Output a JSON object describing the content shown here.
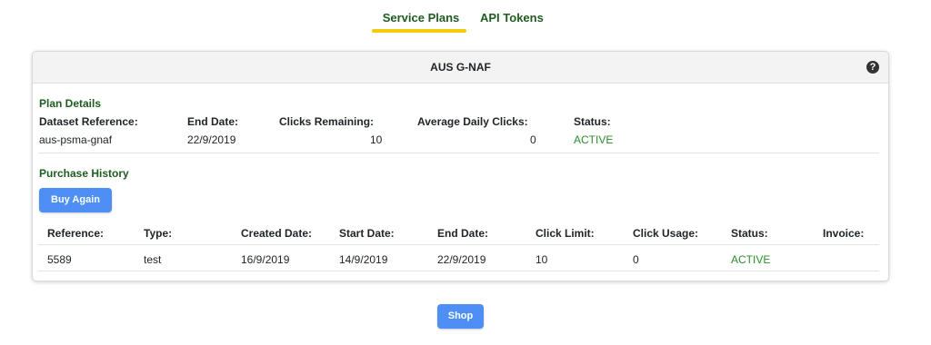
{
  "tabs": [
    {
      "label": "Service Plans",
      "active": true
    },
    {
      "label": "API Tokens",
      "active": false
    }
  ],
  "card": {
    "title": "AUS G-NAF",
    "help_icon": "question-circle-icon"
  },
  "plan_details": {
    "title": "Plan Details",
    "labels": [
      "Dataset Reference:",
      "End Date:",
      "Clicks Remaining:",
      "Average Daily Clicks:",
      "Status:"
    ],
    "values": [
      "aus-psma-gnaf",
      "22/9/2019",
      "10",
      "0",
      "ACTIVE"
    ]
  },
  "purchase_history": {
    "title": "Purchase History",
    "buy_again_label": "Buy Again",
    "columns": [
      "Reference:",
      "Type:",
      "Created Date:",
      "Start Date:",
      "End Date:",
      "Click Limit:",
      "Click Usage:",
      "Status:",
      "Invoice:"
    ],
    "rows": [
      [
        "5589",
        "test",
        "16/9/2019",
        "14/9/2019",
        "22/9/2019",
        "10",
        "0",
        "ACTIVE",
        ""
      ]
    ]
  },
  "shop_label": "Shop",
  "colors": {
    "accent_green": "#1f5c1f",
    "status_active": "#2e8b2e",
    "tab_underline": "#f2cc0c",
    "button_blue": "#4d8ff4"
  }
}
